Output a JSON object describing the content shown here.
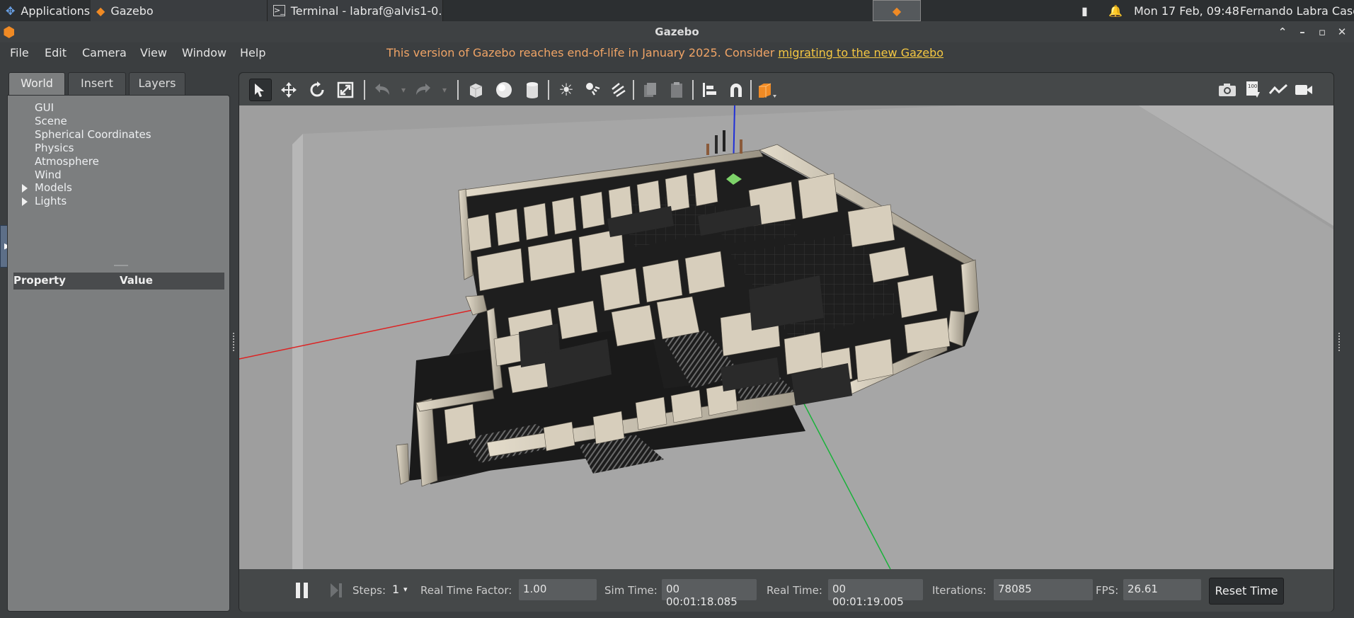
{
  "taskbar": {
    "applications_label": "Applications",
    "window1_label": "Gazebo",
    "window2_label": "Terminal - labraf@alvis1-0...",
    "clock": "Mon 17 Feb, 09:48",
    "user": "Fernando Labra Caso"
  },
  "window": {
    "title": "Gazebo"
  },
  "menu": {
    "items": [
      "File",
      "Edit",
      "Camera",
      "View",
      "Window",
      "Help"
    ],
    "eol_text": "This version of Gazebo reaches end-of-life in January 2025. Consider ",
    "eol_link": "migrating to the new Gazebo"
  },
  "left_panel": {
    "tabs": [
      "World",
      "Insert",
      "Layers"
    ],
    "active_tab": "World",
    "tree": [
      "GUI",
      "Scene",
      "Spherical Coordinates",
      "Physics",
      "Atmosphere",
      "Wind",
      "Models",
      "Lights"
    ],
    "property_header": "Property",
    "value_header": "Value"
  },
  "toolbar": {
    "active_tool": "select-mode",
    "icons": [
      "select-arrow-icon",
      "translate-icon",
      "rotate-icon",
      "scale-icon",
      "undo-icon",
      "redo-icon",
      "box-icon",
      "sphere-icon",
      "cylinder-icon",
      "point-light-icon",
      "spot-light-icon",
      "directional-light-icon",
      "copy-icon",
      "paste-icon",
      "align-icon",
      "snap-icon",
      "change-view-icon",
      "screenshot-icon",
      "log-icon",
      "plot-icon",
      "video-record-icon"
    ]
  },
  "simbar": {
    "steps_label": "Steps:",
    "steps_value": "1",
    "rtf_label": "Real Time Factor:",
    "rtf_value": "1.00",
    "sim_time_label": "Sim Time:",
    "sim_time_value": "00 00:01:18.085",
    "real_time_label": "Real Time:",
    "real_time_value": "00 00:01:19.005",
    "iterations_label": "Iterations:",
    "iterations_value": "78085",
    "fps_label": "FPS:",
    "fps_value": "26.61",
    "reset_label": "Reset Time"
  },
  "colors": {
    "accent_orange": "#f08a24",
    "eol_text": "#f0a466",
    "link": "#f5c842",
    "ground": "#a3a3a3",
    "wall": "#d8cfbd"
  }
}
